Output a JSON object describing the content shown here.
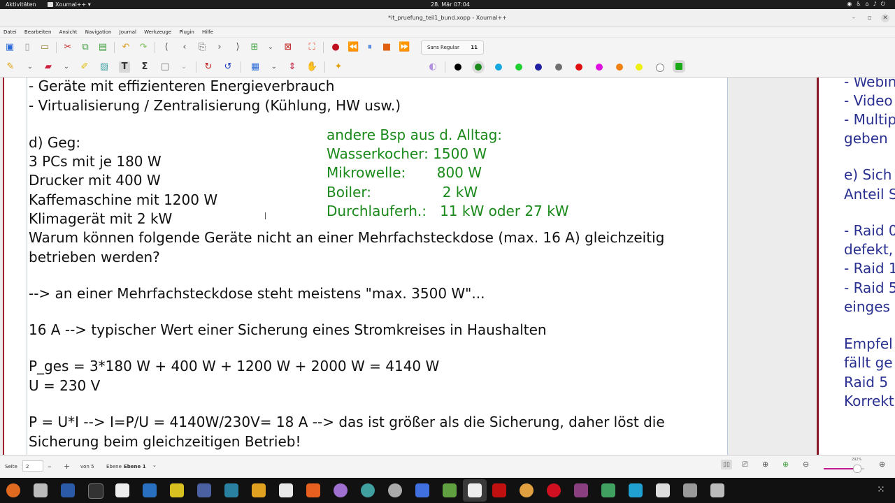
{
  "topbar": {
    "activities": "Aktivitäten",
    "app_name": "Xournal++ ▾",
    "clock": "28. Mär  07:04"
  },
  "window": {
    "title": "*it_pruefung_teil1_bund.xopp - Xournal++"
  },
  "menu": [
    "Datei",
    "Bearbeiten",
    "Ansicht",
    "Navigation",
    "Journal",
    "Werkzeuge",
    "Plugin",
    "Hilfe"
  ],
  "toolbar": {
    "font_name": "Sans Regular",
    "font_size": "11"
  },
  "palette": [
    "#000000",
    "#1a8a1a",
    "#18a8e0",
    "#20d030",
    "#2020a0",
    "#707070",
    "#e01010",
    "#e010e0",
    "#f08010",
    "#f0f010",
    "#ffffff",
    "#18a818"
  ],
  "document": {
    "page1_lines": [
      "- Geräte mit effizienteren Energieverbrauch",
      "- Virtualisierung / Zentralisierung (Kühlung, HW usw.)",
      "d) Geg:",
      "3 PCs mit je 180 W",
      "Drucker mit 400 W",
      "Kaffemaschine mit 1200 W",
      "Klimagerät mit 2 kW",
      "Warum können folgende Geräte nicht an einer Mehrfachsteckdose (max. 16 A) gleichzeitig",
      "betrieben werden?",
      "--> an einer Mehrfachsteckdose steht meistens \"max. 3500 W\"...",
      "16 A --> typischer Wert einer Sicherung eines Stromkreises in Haushalten",
      "P_ges = 3*180 W + 400 W + 1200 W + 2000 W = 4140 W",
      "U = 230 V",
      "P = U*I  --> I=P/U = 4140W/230V= 18 A --> das ist größer als die Sicherung, daher löst die",
      "Sicherung beim gleichzeitigen Betrieb!"
    ],
    "green_note": [
      "andere Bsp aus d. Alltag:",
      "Wasserkocher: 1500 W",
      "Mikrowelle:       800 W",
      "Boiler:                2 kW",
      "Durchlauferh.:   11 kW oder 27 kW"
    ],
    "page2_lines": [
      "- Webin",
      "- Video",
      "- Multip",
      "geben",
      "e) Sich",
      "Anteil S",
      "- Raid 0",
      "defekt,",
      "- Raid 1",
      "- Raid 5",
      "einges",
      "Empfel",
      "fällt ge",
      "Raid 5",
      "Korrekt"
    ]
  },
  "status": {
    "page_label": "Seite",
    "page_value": "2",
    "of_label": "von 5",
    "layer_label": "Ebene",
    "layer_value": "Ebene 1",
    "zoom": "292%",
    "zoom_fraction": 0.72
  }
}
